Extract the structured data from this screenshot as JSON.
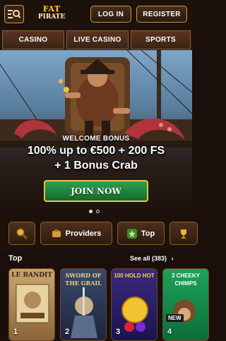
{
  "header": {
    "logo_line1": "FAT",
    "logo_line2": "PIRATE",
    "login_label": "LOG IN",
    "register_label": "REGISTER"
  },
  "categories": [
    {
      "label": "CASINO"
    },
    {
      "label": "LIVE CASINO"
    },
    {
      "label": "SPORTS"
    }
  ],
  "hero": {
    "subtitle": "WELCOME BONUS",
    "line1": "100% up to €500 + 200 FS",
    "line2": "+ 1 Bonus Crab",
    "cta_label": "JOIN NOW",
    "slides_total": 2,
    "active_slide": 1
  },
  "filters": {
    "providers_label": "Providers",
    "top_label": "Top"
  },
  "top_section": {
    "title": "Top",
    "see_all_label": "See all (383)"
  },
  "games": [
    {
      "title": "LE BANDIT",
      "rank": "1"
    },
    {
      "title": "SWORD OF THE GRAIL",
      "rank": "2"
    },
    {
      "title": "100 HOLD HOT",
      "rank": "3"
    },
    {
      "title": "3 CHEEKY CHIMPS",
      "rank": "4",
      "badge": "NEW"
    }
  ],
  "colors": {
    "accent_gold": "#c89a52",
    "cta_green": "#1f8a3f",
    "background": "#1a0f0a"
  }
}
